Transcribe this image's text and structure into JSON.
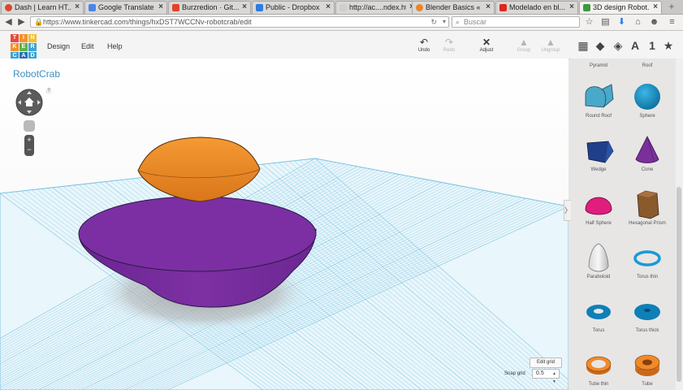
{
  "browser": {
    "tabs": [
      {
        "label": "Dash | Learn HT...",
        "favicon": "dash-icon",
        "color": "#d9482b"
      },
      {
        "label": "Google Translate",
        "favicon": "translate-icon",
        "color": "#4a85e8"
      },
      {
        "label": "Burzredion · Git...",
        "favicon": "gitlab-icon",
        "color": "#e2432a"
      },
      {
        "label": "Public - Dropbox",
        "favicon": "dropbox-icon",
        "color": "#2b7de0"
      },
      {
        "label": "http://ac....ndex.html",
        "favicon": "page-icon",
        "color": "#cccccc"
      },
      {
        "label": "Blender Basics « ...",
        "favicon": "blender-icon",
        "color": "#e8862b"
      },
      {
        "label": "Modelado en bl...",
        "favicon": "youtube-icon",
        "color": "#e0261d"
      },
      {
        "label": "3D design Robot...",
        "favicon": "tinkercad-icon",
        "color": "#3c9a3c"
      }
    ],
    "url": "https://www.tinkercad.com/things/hxDST7WCCNv-robotcrab/edit",
    "search_placeholder": "Buscar"
  },
  "app": {
    "logo_letters": [
      "T",
      "I",
      "N",
      "K",
      "E",
      "R",
      "C",
      "A",
      "D"
    ],
    "menu": [
      "Design",
      "Edit",
      "Help"
    ],
    "tools": {
      "undo": "Undo",
      "redo": "Redo",
      "adjust": "Adjust",
      "group": "Group",
      "ungroup": "Ungroup"
    },
    "panel_tab_text": "1"
  },
  "workplane": {
    "title": "RobotCrab",
    "help_mark": "?",
    "edit_grid": "Edit grid",
    "snap_label": "Snap grid",
    "snap_value": "0.5"
  },
  "shapes": [
    {
      "label": "Pyramid"
    },
    {
      "label": "Roof"
    },
    {
      "label": "Round Roof"
    },
    {
      "label": "Sphere"
    },
    {
      "label": "Wedge"
    },
    {
      "label": "Cone"
    },
    {
      "label": "Half Sphere"
    },
    {
      "label": "Hexagonal Prism"
    },
    {
      "label": "Paraboloid"
    },
    {
      "label": "Torus thin"
    },
    {
      "label": "Torus"
    },
    {
      "label": "Torus thick"
    },
    {
      "label": "Tube thin"
    },
    {
      "label": "Tube"
    }
  ],
  "colors": {
    "link": "#3e8fc2",
    "grid": "#9fd3ea",
    "purple": "#7a2c9e",
    "orange": "#f0841c"
  }
}
